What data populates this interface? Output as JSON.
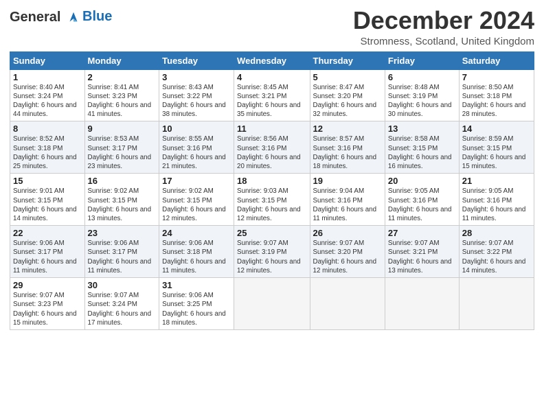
{
  "header": {
    "logo_line1": "General",
    "logo_line2": "Blue",
    "title": "December 2024",
    "subtitle": "Stromness, Scotland, United Kingdom"
  },
  "days_of_week": [
    "Sunday",
    "Monday",
    "Tuesday",
    "Wednesday",
    "Thursday",
    "Friday",
    "Saturday"
  ],
  "weeks": [
    [
      {
        "day": "1",
        "sunrise": "8:40 AM",
        "sunset": "3:24 PM",
        "daylight": "6 hours and 44 minutes."
      },
      {
        "day": "2",
        "sunrise": "8:41 AM",
        "sunset": "3:23 PM",
        "daylight": "6 hours and 41 minutes."
      },
      {
        "day": "3",
        "sunrise": "8:43 AM",
        "sunset": "3:22 PM",
        "daylight": "6 hours and 38 minutes."
      },
      {
        "day": "4",
        "sunrise": "8:45 AM",
        "sunset": "3:21 PM",
        "daylight": "6 hours and 35 minutes."
      },
      {
        "day": "5",
        "sunrise": "8:47 AM",
        "sunset": "3:20 PM",
        "daylight": "6 hours and 32 minutes."
      },
      {
        "day": "6",
        "sunrise": "8:48 AM",
        "sunset": "3:19 PM",
        "daylight": "6 hours and 30 minutes."
      },
      {
        "day": "7",
        "sunrise": "8:50 AM",
        "sunset": "3:18 PM",
        "daylight": "6 hours and 28 minutes."
      }
    ],
    [
      {
        "day": "8",
        "sunrise": "8:52 AM",
        "sunset": "3:18 PM",
        "daylight": "6 hours and 25 minutes."
      },
      {
        "day": "9",
        "sunrise": "8:53 AM",
        "sunset": "3:17 PM",
        "daylight": "6 hours and 23 minutes."
      },
      {
        "day": "10",
        "sunrise": "8:55 AM",
        "sunset": "3:16 PM",
        "daylight": "6 hours and 21 minutes."
      },
      {
        "day": "11",
        "sunrise": "8:56 AM",
        "sunset": "3:16 PM",
        "daylight": "6 hours and 20 minutes."
      },
      {
        "day": "12",
        "sunrise": "8:57 AM",
        "sunset": "3:16 PM",
        "daylight": "6 hours and 18 minutes."
      },
      {
        "day": "13",
        "sunrise": "8:58 AM",
        "sunset": "3:15 PM",
        "daylight": "6 hours and 16 minutes."
      },
      {
        "day": "14",
        "sunrise": "8:59 AM",
        "sunset": "3:15 PM",
        "daylight": "6 hours and 15 minutes."
      }
    ],
    [
      {
        "day": "15",
        "sunrise": "9:01 AM",
        "sunset": "3:15 PM",
        "daylight": "6 hours and 14 minutes."
      },
      {
        "day": "16",
        "sunrise": "9:02 AM",
        "sunset": "3:15 PM",
        "daylight": "6 hours and 13 minutes."
      },
      {
        "day": "17",
        "sunrise": "9:02 AM",
        "sunset": "3:15 PM",
        "daylight": "6 hours and 12 minutes."
      },
      {
        "day": "18",
        "sunrise": "9:03 AM",
        "sunset": "3:15 PM",
        "daylight": "6 hours and 12 minutes."
      },
      {
        "day": "19",
        "sunrise": "9:04 AM",
        "sunset": "3:16 PM",
        "daylight": "6 hours and 11 minutes."
      },
      {
        "day": "20",
        "sunrise": "9:05 AM",
        "sunset": "3:16 PM",
        "daylight": "6 hours and 11 minutes."
      },
      {
        "day": "21",
        "sunrise": "9:05 AM",
        "sunset": "3:16 PM",
        "daylight": "6 hours and 11 minutes."
      }
    ],
    [
      {
        "day": "22",
        "sunrise": "9:06 AM",
        "sunset": "3:17 PM",
        "daylight": "6 hours and 11 minutes."
      },
      {
        "day": "23",
        "sunrise": "9:06 AM",
        "sunset": "3:17 PM",
        "daylight": "6 hours and 11 minutes."
      },
      {
        "day": "24",
        "sunrise": "9:06 AM",
        "sunset": "3:18 PM",
        "daylight": "6 hours and 11 minutes."
      },
      {
        "day": "25",
        "sunrise": "9:07 AM",
        "sunset": "3:19 PM",
        "daylight": "6 hours and 12 minutes."
      },
      {
        "day": "26",
        "sunrise": "9:07 AM",
        "sunset": "3:20 PM",
        "daylight": "6 hours and 12 minutes."
      },
      {
        "day": "27",
        "sunrise": "9:07 AM",
        "sunset": "3:21 PM",
        "daylight": "6 hours and 13 minutes."
      },
      {
        "day": "28",
        "sunrise": "9:07 AM",
        "sunset": "3:22 PM",
        "daylight": "6 hours and 14 minutes."
      }
    ],
    [
      {
        "day": "29",
        "sunrise": "9:07 AM",
        "sunset": "3:23 PM",
        "daylight": "6 hours and 15 minutes."
      },
      {
        "day": "30",
        "sunrise": "9:07 AM",
        "sunset": "3:24 PM",
        "daylight": "6 hours and 17 minutes."
      },
      {
        "day": "31",
        "sunrise": "9:06 AM",
        "sunset": "3:25 PM",
        "daylight": "6 hours and 18 minutes."
      },
      null,
      null,
      null,
      null
    ]
  ],
  "labels": {
    "sunrise_label": "Sunrise: ",
    "sunset_label": "Sunset: ",
    "daylight_label": "Daylight: "
  }
}
